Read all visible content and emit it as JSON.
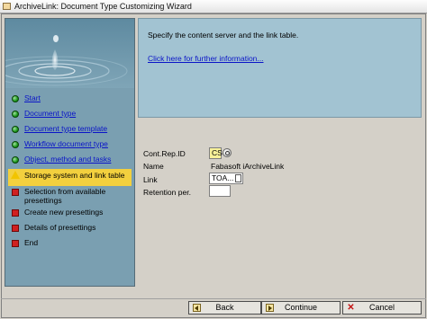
{
  "window": {
    "title": "ArchiveLink: Document Type Customizing Wizard"
  },
  "steps": [
    {
      "label": "Start",
      "status": "done"
    },
    {
      "label": "Document type",
      "status": "done"
    },
    {
      "label": "Document type template",
      "status": "done"
    },
    {
      "label": "Workflow document type",
      "status": "done"
    },
    {
      "label": "Object, method and tasks",
      "status": "done"
    },
    {
      "label": "Storage system and link table",
      "status": "current"
    },
    {
      "label": "Selection from available presettings",
      "status": "todo"
    },
    {
      "label": "Create new presettings",
      "status": "todo"
    },
    {
      "label": "Details of presettings",
      "status": "todo"
    },
    {
      "label": "End",
      "status": "todo"
    }
  ],
  "info": {
    "instruction": "Specify the content server and the link table.",
    "link": "Click here for further information..."
  },
  "form": {
    "cont_rep_id_label": "Cont.Rep.ID",
    "cont_rep_id_value": "CS",
    "name_label": "Name",
    "name_value": "Fabasoft iArchiveLink",
    "link_label": "Link",
    "link_value": "TOA...",
    "retention_label": "Retention per.",
    "retention_value": ""
  },
  "buttons": {
    "back": "Back",
    "continue": "Continue",
    "cancel": "Cancel"
  },
  "colors": {
    "left_panel": "#7a9fb1",
    "info_panel": "#a2c3d2",
    "active_step": "#f3d03e",
    "link": "#0a14c8"
  }
}
